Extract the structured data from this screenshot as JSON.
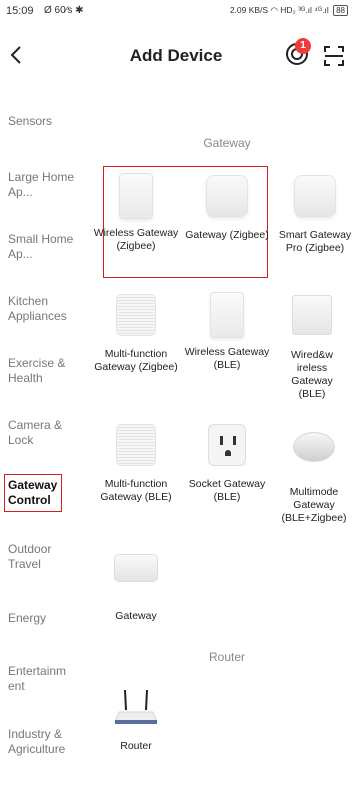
{
  "status_bar": {
    "time": "15:09",
    "indicators": "Ø 60⁄s ✱",
    "net_speed": "2.09 KB/S",
    "signal_text": "HD₂ ³ᴳ.ıl ⁴ᴳ.ıl",
    "battery": "88"
  },
  "header": {
    "title": "Add Device",
    "badge_count": "1"
  },
  "sidebar": {
    "items": [
      {
        "label": "Sensors"
      },
      {
        "label": "Large Home Ap..."
      },
      {
        "label": "Small Home Ap..."
      },
      {
        "label": "Kitchen Appliances"
      },
      {
        "label": "Exercise & Health"
      },
      {
        "label": "Camera & Lock"
      },
      {
        "label": "Gateway Control"
      },
      {
        "label": "Outdoor Travel"
      },
      {
        "label": "Energy"
      },
      {
        "label": "Entertainm ent"
      },
      {
        "label": "Industry & Agriculture"
      }
    ],
    "active": "Gateway Control"
  },
  "sections": {
    "gateway": "Gateway",
    "router": "Router"
  },
  "devices": [
    {
      "label": "Wireless Gateway (Zigbee)",
      "icon": "gateway-box-icon"
    },
    {
      "label": "Gateway (Zigbee)",
      "icon": "gateway-square-icon"
    },
    {
      "label": "Smart Gateway Pro (Zigbee)",
      "icon": "gateway-square-icon"
    },
    {
      "label": "Multi-function Gateway (Zigbee)",
      "icon": "gateway-grill-icon"
    },
    {
      "label": "Wireless Gateway (BLE)",
      "icon": "gateway-box-icon"
    },
    {
      "label": "Wired&w ireless Gateway (BLE)",
      "icon": "gateway-slim-icon"
    },
    {
      "label": "Multi-function Gateway (BLE)",
      "icon": "gateway-grill-icon"
    },
    {
      "label": "Socket Gateway (BLE)",
      "icon": "socket-gateway-icon"
    },
    {
      "label": "Multimode Gateway (BLE+Zigbee)",
      "icon": "gateway-puck-icon"
    },
    {
      "label": "Gateway",
      "icon": "gateway-flat-icon"
    },
    {
      "label": "Router",
      "icon": "router-icon"
    }
  ],
  "colors": {
    "highlight": "#d21f1f",
    "badge": "#ef3b3b",
    "muted_text": "#777777"
  }
}
